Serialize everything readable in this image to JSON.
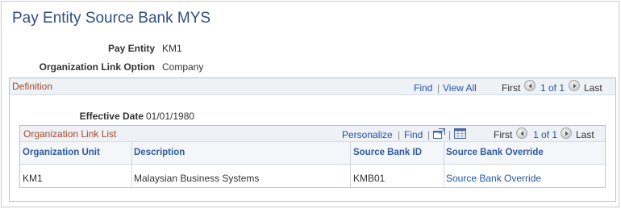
{
  "page": {
    "title": "Pay Entity Source Bank MYS"
  },
  "fields": {
    "pay_entity_label": "Pay Entity",
    "pay_entity_value": "KM1",
    "org_link_label": "Organization Link Option",
    "org_link_value": "Company"
  },
  "definition": {
    "title": "Definition",
    "find": "Find",
    "sep": "|",
    "view_all": "View All",
    "first": "First",
    "range": "1 of 1",
    "last": "Last",
    "effective_date_label": "Effective Date",
    "effective_date_value": "01/01/1980"
  },
  "grid": {
    "title": "Organization Link List",
    "personalize": "Personalize",
    "sep": "|",
    "find": "Find",
    "first": "First",
    "range": "1 of 1",
    "last": "Last",
    "columns": [
      "Organization Unit",
      "Description",
      "Source Bank ID",
      "Source Bank Override"
    ],
    "rows": [
      {
        "org_unit": "KM1",
        "description": "Malaysian Business Systems",
        "source_bank_id": "KMB01",
        "override_link": "Source Bank Override"
      }
    ]
  },
  "icons": {
    "prev": "chevron-left-icon",
    "next": "chevron-right-icon",
    "zoom": "new-window-icon",
    "download": "spreadsheet-icon"
  },
  "colors": {
    "title": "#2e4f82",
    "section_title": "#a54a2a",
    "link": "#2255a5",
    "header_bg": "#eef1f6"
  }
}
